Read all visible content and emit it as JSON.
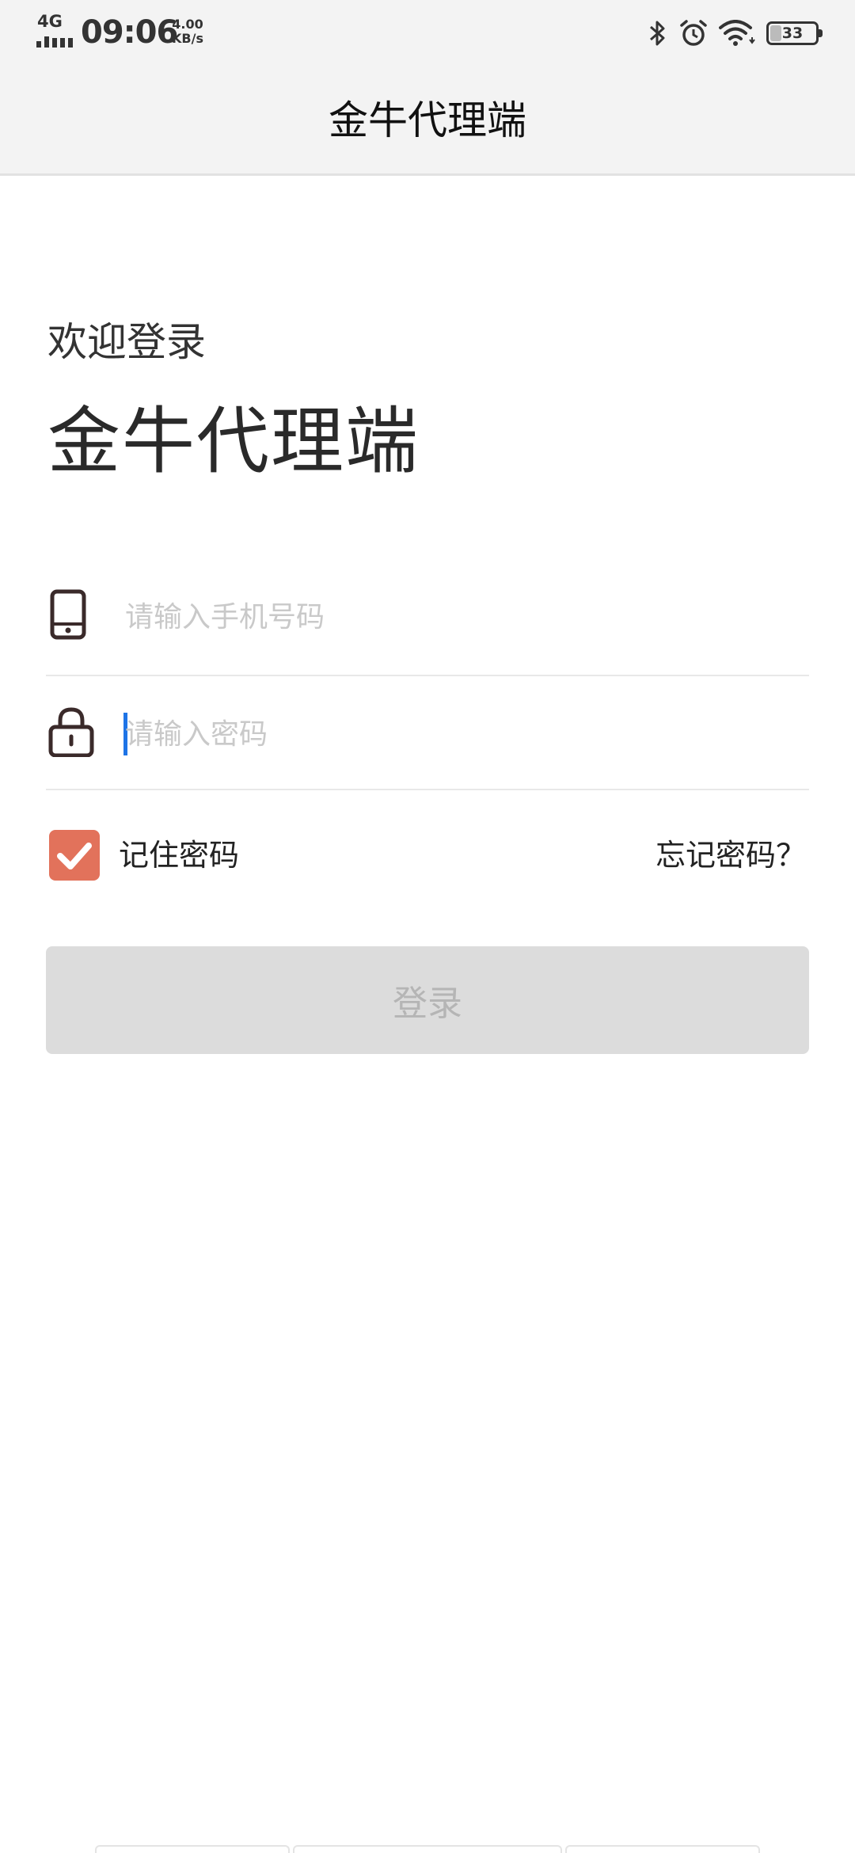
{
  "status_bar": {
    "network": "4G",
    "time": "09:06",
    "speed_value": "4.00",
    "speed_unit": "KB/s",
    "battery": "33"
  },
  "header": {
    "title": "金牛代理端"
  },
  "welcome": {
    "greeting": "欢迎登录",
    "app_name": "金牛代理端"
  },
  "form": {
    "phone_placeholder": "请输入手机号码",
    "password_placeholder": "请输入密码",
    "remember_label": "记住密码",
    "remember_checked": true,
    "forgot_label": "忘记密码？",
    "login_label": "登录"
  },
  "colors": {
    "checkbox": "#e2725b",
    "caret": "#1e74e6",
    "button_disabled_bg": "#dcdcdc",
    "button_disabled_text": "#b5b5b5"
  }
}
